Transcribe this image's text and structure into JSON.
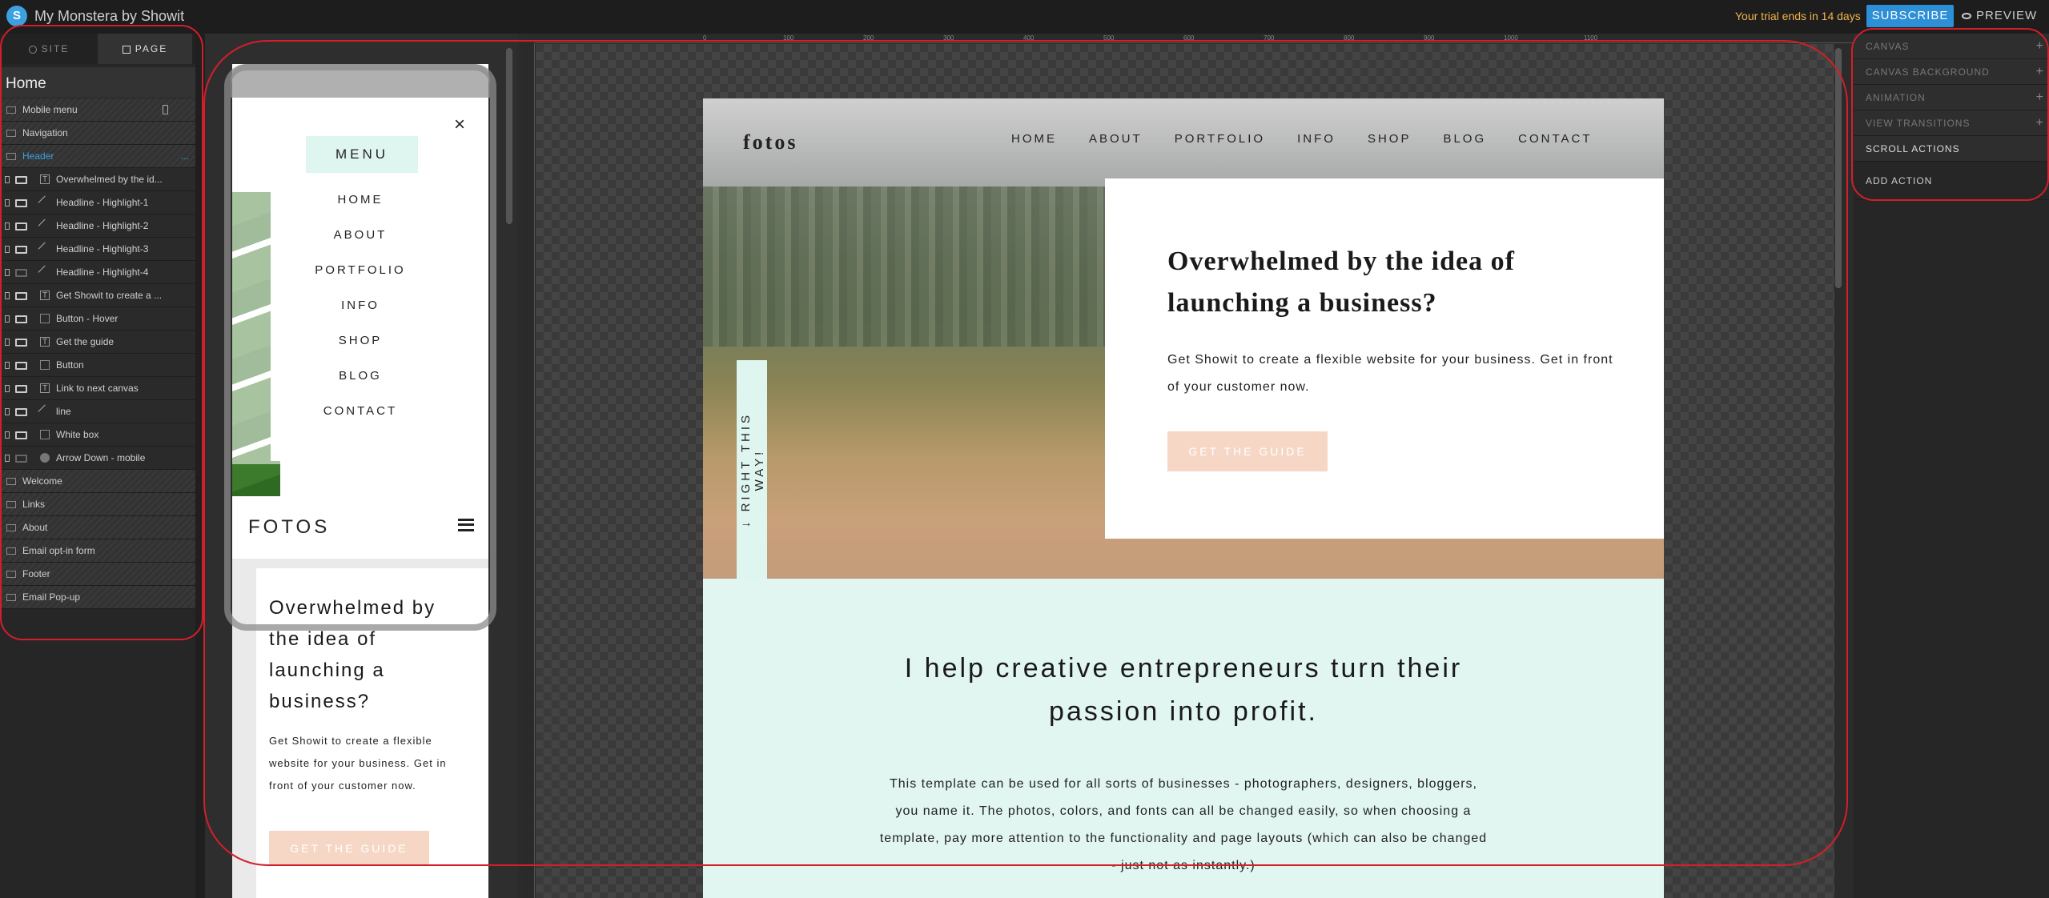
{
  "app": {
    "title": "My Monstera by Showit",
    "trial_text": "Your trial ends in 14 days",
    "subscribe_label": "SUBSCRIBE",
    "preview_label": "PREVIEW"
  },
  "left_panel": {
    "tabs": [
      {
        "label": "SITE"
      },
      {
        "label": "PAGE"
      }
    ],
    "page_name": "Home",
    "sections_before": [
      {
        "label": "Mobile menu"
      },
      {
        "label": "Navigation"
      },
      {
        "label": "Header",
        "options": "..."
      }
    ],
    "header_items": [
      {
        "label": "Overwhelmed by the id...",
        "icon": "text-icon"
      },
      {
        "label": "Headline - Highlight-1",
        "icon": "line-icon"
      },
      {
        "label": "Headline - Highlight-2",
        "icon": "line-icon"
      },
      {
        "label": "Headline - Highlight-3",
        "icon": "line-icon"
      },
      {
        "label": "Headline - Highlight-4",
        "icon": "line-icon"
      },
      {
        "label": "Get Showit to create a ...",
        "icon": "text-icon"
      },
      {
        "label": "Button - Hover",
        "icon": "shape-icon"
      },
      {
        "label": "Get the guide",
        "icon": "text-icon"
      },
      {
        "label": "Button",
        "icon": "shape-icon"
      },
      {
        "label": "Link to next canvas",
        "icon": "text-icon"
      },
      {
        "label": "line",
        "icon": "line-icon"
      },
      {
        "label": "White box",
        "icon": "shape-icon"
      },
      {
        "label": "Arrow Down - mobile",
        "icon": "circle-icon"
      }
    ],
    "sections_after": [
      {
        "label": "Welcome"
      },
      {
        "label": "Links"
      },
      {
        "label": "About"
      },
      {
        "label": "Email opt-in form"
      },
      {
        "label": "Footer"
      },
      {
        "label": "Email Pop-up"
      }
    ]
  },
  "desktop_page": {
    "logo": "fotos",
    "nav": [
      "HOME",
      "ABOUT",
      "PORTFOLIO",
      "INFO",
      "SHOP",
      "BLOG",
      "CONTACT"
    ],
    "hero_heading": "Overwhelmed by the idea of launching a business?",
    "hero_text": "Get Showit to create a flexible website for your business. Get in front of your customer now.",
    "hero_button": "GET THE GUIDE",
    "side_tab": "↓ RIGHT THIS WAY!",
    "welcome_heading": "I help creative entrepreneurs turn their passion into profit.",
    "welcome_text": "This template can be used for all sorts of businesses - photographers, designers, bloggers, you name it. The photos, colors, and fonts can all be changed easily, so when choosing a template, pay more attention to the functionality and page layouts (which can also be changed - just not as instantly.)"
  },
  "mobile_page": {
    "menu_label": "MENU",
    "close_glyph": "×",
    "menu_items": [
      "HOME",
      "ABOUT",
      "PORTFOLIO",
      "INFO",
      "SHOP",
      "BLOG",
      "CONTACT"
    ],
    "logo": "FOTOS",
    "hero_heading": "Overwhelmed by the idea of launching a business?",
    "hero_text": "Get Showit to create a flexible website for your business. Get in front of your customer now.",
    "hero_button": "GET THE GUIDE"
  },
  "ruler": {
    "ticks": [
      "0",
      "100",
      "200",
      "300",
      "400",
      "500",
      "600",
      "700",
      "800",
      "900",
      "1000",
      "1100"
    ]
  },
  "right_panel": {
    "items": [
      {
        "label": "CANVAS",
        "plus": "+"
      },
      {
        "label": "CANVAS BACKGROUND",
        "plus": "+"
      },
      {
        "label": "ANIMATION",
        "plus": "+"
      },
      {
        "label": "VIEW TRANSITIONS",
        "plus": "+"
      }
    ],
    "scroll_actions_label": "SCROLL ACTIONS",
    "add_action_label": "ADD ACTION"
  },
  "colors": {
    "accent": "#3da0e0",
    "trial": "#f2b34a",
    "mint": "#dff5ef",
    "peach": "#f6d7c6",
    "annotation": "#d21f2a"
  }
}
